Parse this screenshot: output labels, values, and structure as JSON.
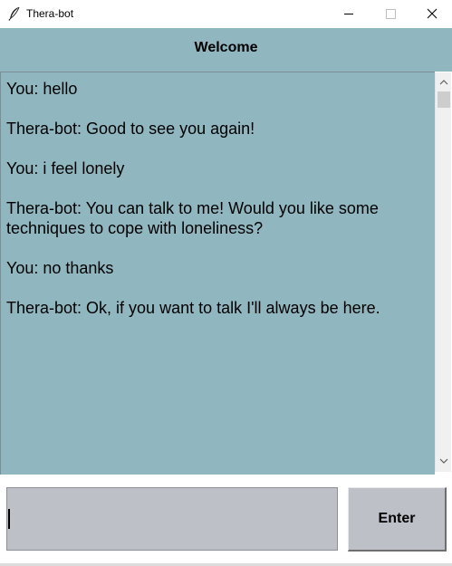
{
  "window": {
    "title": "Thera-bot",
    "icon": "feather-icon"
  },
  "header": {
    "title": "Welcome"
  },
  "chat": {
    "messages": [
      "You: hello",
      "Thera-bot: Good to see you again!",
      "You: i feel lonely",
      "Thera-bot: You can talk to me! Would you like some techniques to cope with loneliness?",
      "You: no thanks",
      "Thera-bot: Ok, if you want to talk I'll always be here."
    ]
  },
  "input": {
    "value": "",
    "placeholder": ""
  },
  "controls": {
    "enter_label": "Enter"
  },
  "colors": {
    "background": "#90b6bf",
    "input_background": "#bdc0c7"
  }
}
